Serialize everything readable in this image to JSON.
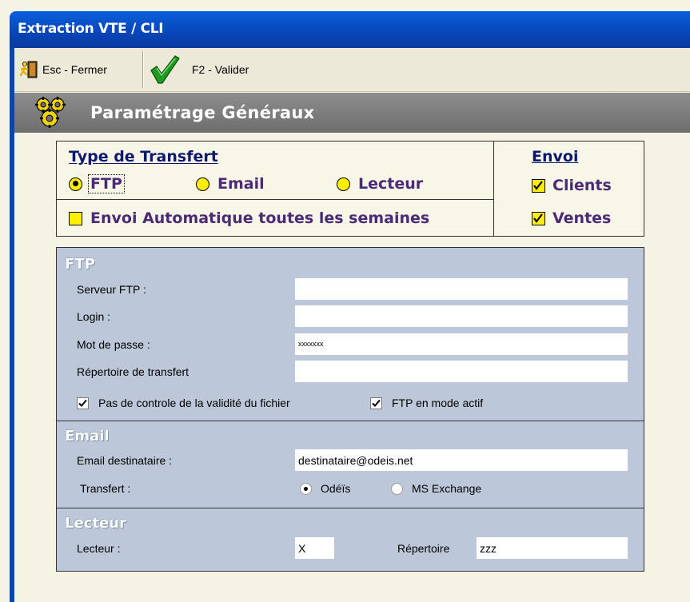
{
  "window": {
    "title": "Extraction VTE / CLI"
  },
  "toolbar": {
    "close_label": "Esc - Fermer",
    "validate_label": "F2 - Valider"
  },
  "section": {
    "title": "Paramétrage Généraux"
  },
  "transfer": {
    "title": "Type de Transfert",
    "options": [
      {
        "label": "FTP",
        "selected": true
      },
      {
        "label": "Email",
        "selected": false
      },
      {
        "label": "Lecteur",
        "selected": false
      }
    ],
    "auto_weekly_label": "Envoi Automatique toutes les semaines",
    "auto_weekly_checked": false
  },
  "envoi": {
    "title": "Envoi",
    "clients_label": "Clients",
    "clients_checked": true,
    "ventes_label": "Ventes",
    "ventes_checked": true
  },
  "ftp": {
    "title": "FTP",
    "server_label": "Serveur FTP :",
    "server_value": "",
    "login_label": "Login :",
    "login_value": "",
    "password_label": "Mot de passe :",
    "password_value": "xxxxxxx",
    "dir_label": "Répertoire de transfert",
    "dir_value": "",
    "no_validation_label": "Pas de controle de la validité du fichier",
    "no_validation_checked": true,
    "active_mode_label": "FTP en mode actif",
    "active_mode_checked": true
  },
  "email": {
    "title": "Email",
    "recipient_label": "Email destinataire :",
    "recipient_value": "destinataire@odeis.net",
    "transfer_label": "Transfert :",
    "transfer_options": [
      {
        "label": "Odéïs",
        "selected": true
      },
      {
        "label": "MS Exchange",
        "selected": false
      }
    ]
  },
  "lecteur": {
    "title": "Lecteur",
    "drive_label": "Lecteur :",
    "drive_value": "X",
    "dir_label": "Répertoire",
    "dir_value": "zzz"
  },
  "colors": {
    "title_blue": "#0845b8",
    "panel_blue": "#bcc8d9",
    "yellow": "#ffee00",
    "purple": "#4b2a78"
  }
}
